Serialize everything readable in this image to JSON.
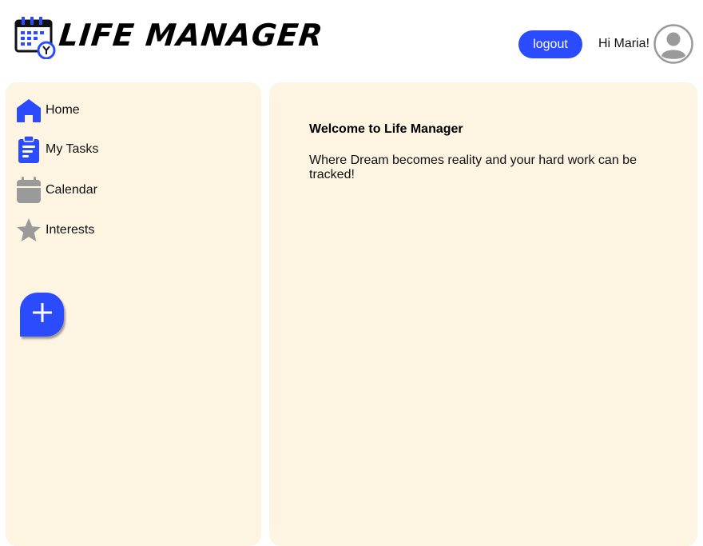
{
  "header": {
    "app_title": "LIFE MANAGER",
    "logo_icon": "calendar-clock-icon",
    "logout_label": "logout",
    "greeting": "Hi Maria!",
    "avatar_icon": "user-avatar-icon"
  },
  "sidebar": {
    "items": [
      {
        "label": "Home",
        "icon": "home-icon",
        "color": "#2b4bff"
      },
      {
        "label": "My Tasks",
        "icon": "clipboard-icon",
        "color": "#2b4bff"
      },
      {
        "label": "Calendar",
        "icon": "calendar-icon",
        "color": "#9a9a9a"
      },
      {
        "label": "Interests",
        "icon": "star-icon",
        "color": "#9a9a9a"
      }
    ],
    "add_button_icon": "plus-icon"
  },
  "main": {
    "welcome_title": "Welcome to Life Manager",
    "welcome_text": "Where Dream becomes reality and your hard work can be tracked!"
  },
  "colors": {
    "accent": "#2b4bff",
    "panel_background": "#fdf4e1",
    "inactive_icon": "#9a9a9a"
  }
}
